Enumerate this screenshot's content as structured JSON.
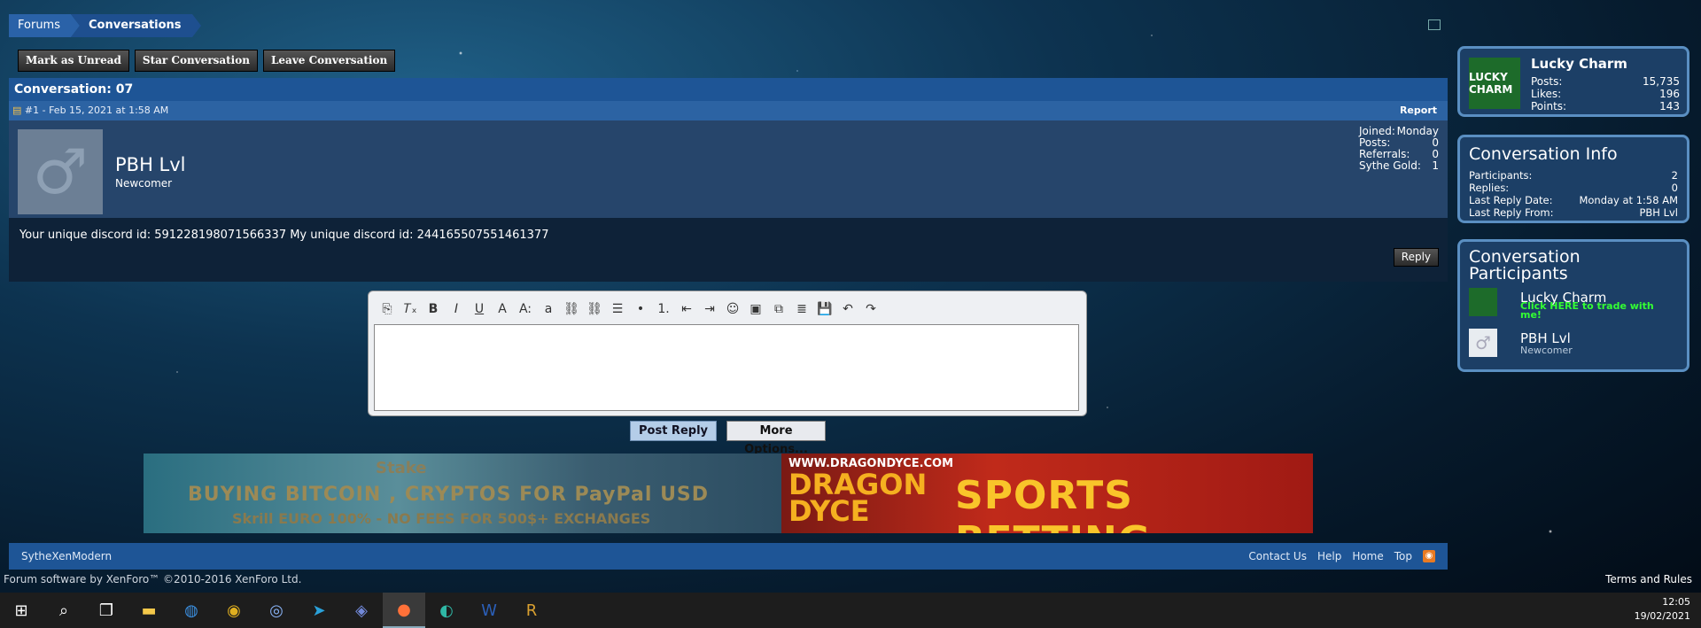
{
  "breadcrumb": {
    "items": [
      "Forums",
      "Conversations"
    ]
  },
  "actions": {
    "mark_unread": "Mark as Unread",
    "star": "Star Conversation",
    "leave": "Leave Conversation"
  },
  "conversation": {
    "title": "Conversation: 07",
    "message": {
      "meta": "#1 - Feb 15, 2021 at 1:58 AM",
      "report": "Report",
      "username": "PBH Lvl",
      "user_title": "Newcomer",
      "stats": [
        {
          "k": "Joined:",
          "v": "Monday"
        },
        {
          "k": "Posts:",
          "v": "0"
        },
        {
          "k": "Referrals:",
          "v": "0"
        },
        {
          "k": "Sythe Gold:",
          "v": "1"
        }
      ],
      "text": "Your unique discord id: 591228198071566337 My unique discord id: 244165507551461377",
      "reply": "Reply"
    }
  },
  "editor": {
    "post_reply": "Post Reply",
    "more_options": "More Options...",
    "toolbar": [
      "⎘",
      "𝑇ₓ",
      "B",
      "I",
      "U",
      "A",
      "A:",
      "a",
      "⛓",
      "⛓",
      "☰",
      "•",
      "1.",
      "⇤",
      "⇥",
      "☺",
      "▣",
      "⧉",
      "≣",
      "💾",
      "↶",
      "↷"
    ]
  },
  "banners": {
    "left": {
      "stake": "Stake",
      "line1": "BUYING BITCOIN , CRYPTOS FOR PayPal USD",
      "line2": "Skrill EURO 100% - NO FEES FOR 500$+ EXCHANGES"
    },
    "right": {
      "url": "WWW.DRAGONDYCE.COM",
      "brand": "DRAGON DYCE",
      "tag": "SPORTS BETTING"
    }
  },
  "sidebar": {
    "profile": {
      "name": "Lucky Charm",
      "avatar_text": "LUCKY CHARM",
      "stats": [
        {
          "k": "Posts:",
          "v": "15,735"
        },
        {
          "k": "Likes:",
          "v": "196"
        },
        {
          "k": "Points:",
          "v": "143"
        }
      ]
    },
    "info": {
      "title": "Conversation Info",
      "rows": [
        {
          "k": "Participants:",
          "v": "2"
        },
        {
          "k": "Replies:",
          "v": "0"
        },
        {
          "k": "Last Reply Date:",
          "v": "Monday at 1:58 AM"
        },
        {
          "k": "Last Reply From:",
          "v": "PBH Lvl"
        }
      ]
    },
    "participants": {
      "title": "Conversation Participants",
      "list": [
        {
          "name": "Lucky Charm",
          "sub": "Click HERE to trade with me!"
        },
        {
          "name": "PBH Lvl",
          "sub": "Newcomer"
        }
      ]
    }
  },
  "footer": {
    "style": "SytheXenModern",
    "links": [
      "Contact Us",
      "Help",
      "Home",
      "Top"
    ],
    "copyright": "Forum software by XenForo™ ©2010-2016 XenForo Ltd.",
    "terms": "Terms and Rules"
  },
  "taskbar": {
    "time": "12:05",
    "date": "19/02/2021"
  }
}
